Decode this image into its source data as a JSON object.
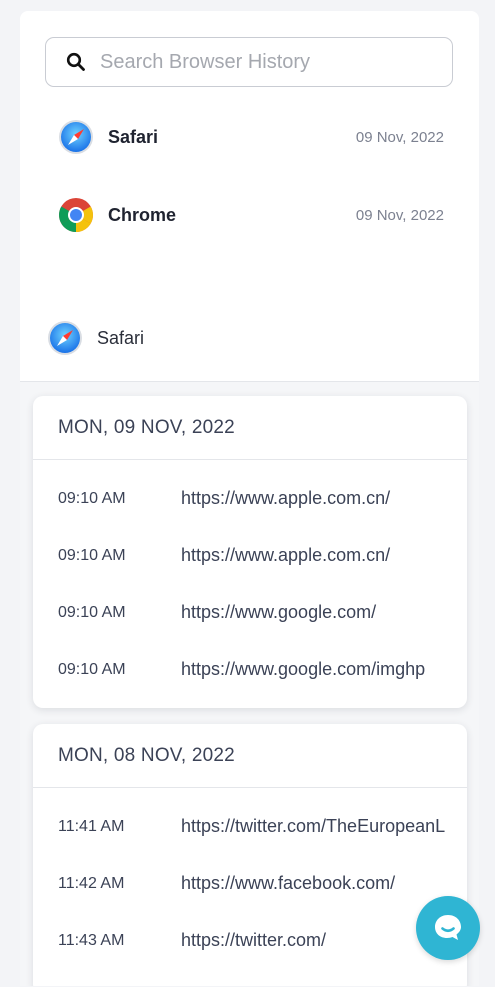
{
  "search": {
    "placeholder": "Search Browser History",
    "value": ""
  },
  "browsers": [
    {
      "name": "Safari",
      "date": "09 Nov, 2022",
      "icon": "safari-icon"
    },
    {
      "name": "Chrome",
      "date": "09 Nov, 2022",
      "icon": "chrome-icon"
    }
  ],
  "selected_browser": {
    "name": "Safari",
    "icon": "safari-icon"
  },
  "days": [
    {
      "title": "MON, 09 NOV, 2022",
      "entries": [
        {
          "time": "09:10 AM",
          "url": "https://www.apple.com.cn/"
        },
        {
          "time": "09:10 AM",
          "url": "https://www.apple.com.cn/"
        },
        {
          "time": "09:10 AM",
          "url": "https://www.google.com/"
        },
        {
          "time": "09:10 AM",
          "url": "https://www.google.com/imghp"
        }
      ]
    },
    {
      "title": "MON, 08 NOV, 2022",
      "entries": [
        {
          "time": "11:41 AM",
          "url": "https://twitter.com/TheEuropeanL"
        },
        {
          "time": "11:42 AM",
          "url": "https://www.facebook.com/"
        },
        {
          "time": "11:43 AM",
          "url": "https://twitter.com/"
        }
      ]
    }
  ],
  "chat": {
    "icon": "chat-icon"
  },
  "colors": {
    "accent": "#2fb5d3",
    "text": "#3b4256",
    "muted": "#7c8190"
  }
}
